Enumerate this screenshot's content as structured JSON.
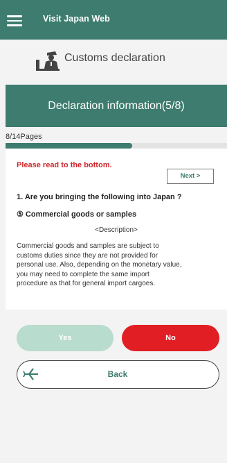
{
  "header": {
    "title": "Visit Japan Web",
    "menu_icon": "hamburger-menu-icon"
  },
  "section": {
    "title": "Customs declaration",
    "icon": "customs-officer-icon"
  },
  "banner": {
    "title": "Declaration information(5/8)"
  },
  "progress": {
    "label": "8/14Pages",
    "current": 8,
    "total": 14
  },
  "content": {
    "read_note": "Please read to the bottom.",
    "next_label": "Next >",
    "question": "1. Are you bringing the following into Japan ?",
    "item": "⑤ Commercial goods or samples",
    "description_heading": "<Description>",
    "description_lines": [
      "Commercial goods and samples are subject to",
      "customs duties since they are not provided for",
      "personal use. Also, depending on the monetary value,",
      "you may need to complete the same import",
      "procedure as that for general import cargoes."
    ]
  },
  "actions": {
    "yes_label": "Yes",
    "no_label": "No",
    "back_label": "Back",
    "back_icon": "departure-airplane-icon"
  },
  "colors": {
    "brand": "#3d7c6e",
    "alert": "#d0282d",
    "no_button": "#e01e24",
    "yes_button_disabled": "#b8dccd"
  }
}
